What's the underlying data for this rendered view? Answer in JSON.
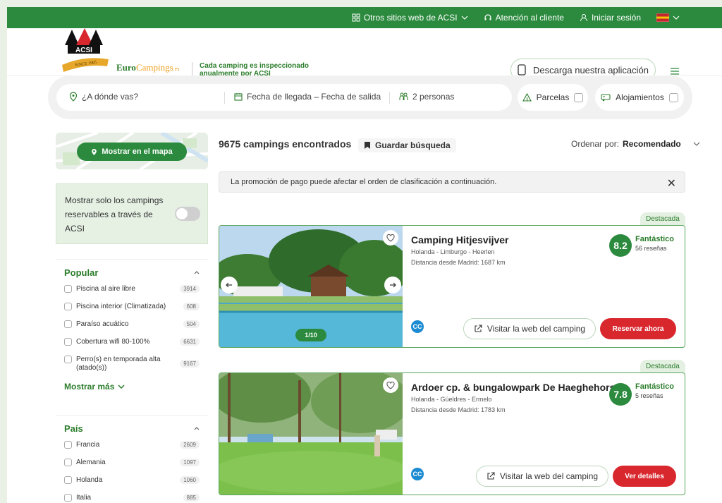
{
  "topbar": {
    "other_sites": "Otros sitios web de ACSI",
    "support": "Atención al cliente",
    "login": "Iniciar sesión"
  },
  "header": {
    "logo_text": "ACSI",
    "logo_since": "SINCE 1965",
    "brand_euro": "Euro",
    "brand_campings": "Campings",
    "brand_suffix": ".es",
    "tagline": "Cada camping es inspeccionado anualmente por ACSI",
    "app_button": "Descarga nuestra aplicación"
  },
  "search": {
    "where_placeholder": "¿A dónde vas?",
    "dates_placeholder": "Fecha de llegada – Fecha de salida",
    "guests": "2 personas",
    "pitches": "Parcelas",
    "accommodations": "Alojamientos"
  },
  "sidebar": {
    "map_button": "Mostrar en el mapa",
    "reservable_text": "Mostrar solo los campings reservables a través de ACSI",
    "popular": {
      "title": "Popular",
      "items": [
        {
          "label": "Piscina al aire libre",
          "count": "3914"
        },
        {
          "label": "Piscina interior (Climatizada)",
          "count": "608"
        },
        {
          "label": "Paraíso acuático",
          "count": "504"
        },
        {
          "label": "Cobertura wifi 80-100%",
          "count": "6631"
        },
        {
          "label": "Perro(s) en temporada alta (atado(s))",
          "count": "9167"
        }
      ],
      "show_more": "Mostrar más"
    },
    "country": {
      "title": "País",
      "items": [
        {
          "label": "Francia",
          "count": "2609"
        },
        {
          "label": "Alemania",
          "count": "1097"
        },
        {
          "label": "Holanda",
          "count": "1060"
        },
        {
          "label": "Italia",
          "count": "885"
        }
      ]
    }
  },
  "results": {
    "count_text": "9675 campings encontrados",
    "save_search": "Guardar búsqueda",
    "sort_label": "Ordenar por:",
    "sort_value": "Recomendado",
    "promo_notice": "La promoción de pago puede afectar el orden de clasificación a continuación.",
    "cards": [
      {
        "badge": "Destacada",
        "name": "Camping Hitjesvijver",
        "location": "Holanda - Limburgo - Heerlen",
        "distance": "Distancia desde Madrid: 1687 km",
        "score": "8.2",
        "score_label": "Fantástico",
        "reviews": "56 reseñas",
        "photo_counter": "1/10",
        "cc": "CC",
        "visit": "Visitar la web del camping",
        "action": "Reservar ahora"
      },
      {
        "badge": "Destacada",
        "name": "Ardoer cp. & bungalowpark De Haeghehorst",
        "location": "Holanda - Güeldres - Ermelo",
        "distance": "Distancia desde Madrid: 1783 km",
        "score": "7.8",
        "score_label": "Fantástico",
        "reviews": "5 reseñas",
        "cc": "CC",
        "visit": "Visitar la web del camping",
        "action": "Ver detalles"
      }
    ]
  },
  "colors": {
    "brand_green": "#2b8a3e",
    "accent_red": "#d9272e",
    "cc_blue": "#1d8bd1"
  }
}
